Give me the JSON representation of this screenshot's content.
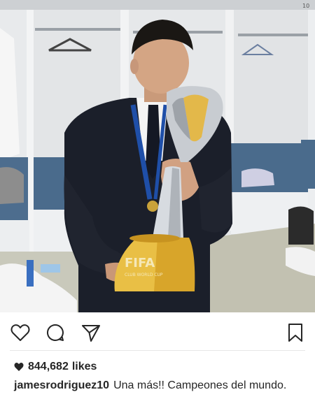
{
  "post": {
    "image_alt": "Man in dark suit kissing a gold and silver trophy in a locker room",
    "trophy_text": "FIFA",
    "trophy_subtext": "CLUB WORLD CUP",
    "locker_number": "10"
  },
  "actions": {
    "like_icon": "heart-outline-icon",
    "comment_icon": "comment-icon",
    "share_icon": "paper-plane-icon",
    "save_icon": "bookmark-icon"
  },
  "likes": {
    "count": "844,682",
    "label": "likes"
  },
  "caption": {
    "username": "jamesrodriguez10",
    "text": "Una más!! Campeones del mundo."
  },
  "colors": {
    "text": "#262626",
    "divider": "#e6e6e6",
    "suit": "#1b1f2a",
    "trophy_gold": "#d8a52a",
    "trophy_silver": "#c8ccd1",
    "lanyard": "#1f4fa8",
    "bench": "#4a6b8c"
  }
}
